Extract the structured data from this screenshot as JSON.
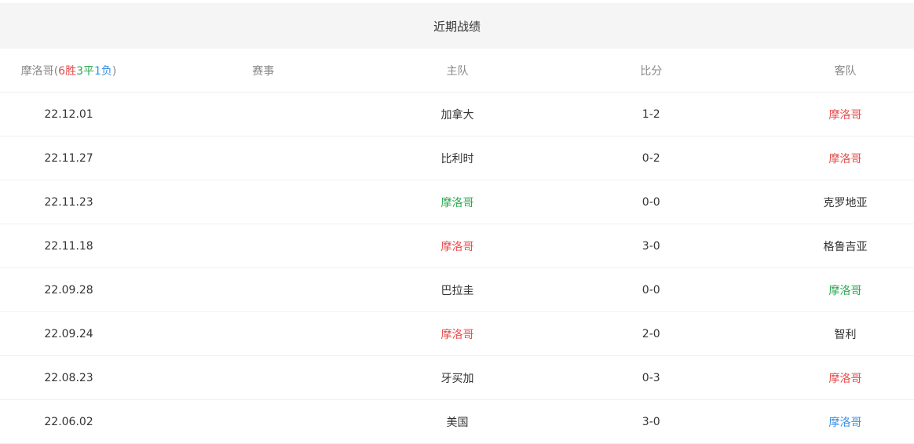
{
  "title": "近期战绩",
  "summary": {
    "team": "摩洛哥",
    "open": "(",
    "wins": "6胜",
    "draws": "3平",
    "losses": "1负",
    "close": ")"
  },
  "columns": {
    "event": "赛事",
    "home": "主队",
    "score": "比分",
    "away": "客队"
  },
  "colors": {
    "win": "#e94b4b",
    "draw": "#2aa84f",
    "loss": "#3a8fe0"
  },
  "matches": [
    {
      "date": "22.12.01",
      "event": "",
      "home": "加拿大",
      "home_color": "dark",
      "score": "1-2",
      "away": "摩洛哥",
      "away_color": "red"
    },
    {
      "date": "22.11.27",
      "event": "",
      "home": "比利时",
      "home_color": "dark",
      "score": "0-2",
      "away": "摩洛哥",
      "away_color": "red"
    },
    {
      "date": "22.11.23",
      "event": "",
      "home": "摩洛哥",
      "home_color": "green",
      "score": "0-0",
      "away": "克罗地亚",
      "away_color": "dark"
    },
    {
      "date": "22.11.18",
      "event": "",
      "home": "摩洛哥",
      "home_color": "red",
      "score": "3-0",
      "away": "格鲁吉亚",
      "away_color": "dark"
    },
    {
      "date": "22.09.28",
      "event": "",
      "home": "巴拉圭",
      "home_color": "dark",
      "score": "0-0",
      "away": "摩洛哥",
      "away_color": "green"
    },
    {
      "date": "22.09.24",
      "event": "",
      "home": "摩洛哥",
      "home_color": "red",
      "score": "2-0",
      "away": "智利",
      "away_color": "dark"
    },
    {
      "date": "22.08.23",
      "event": "",
      "home": "牙买加",
      "home_color": "dark",
      "score": "0-3",
      "away": "摩洛哥",
      "away_color": "red"
    },
    {
      "date": "22.06.02",
      "event": "",
      "home": "美国",
      "home_color": "dark",
      "score": "3-0",
      "away": "摩洛哥",
      "away_color": "blue"
    }
  ]
}
